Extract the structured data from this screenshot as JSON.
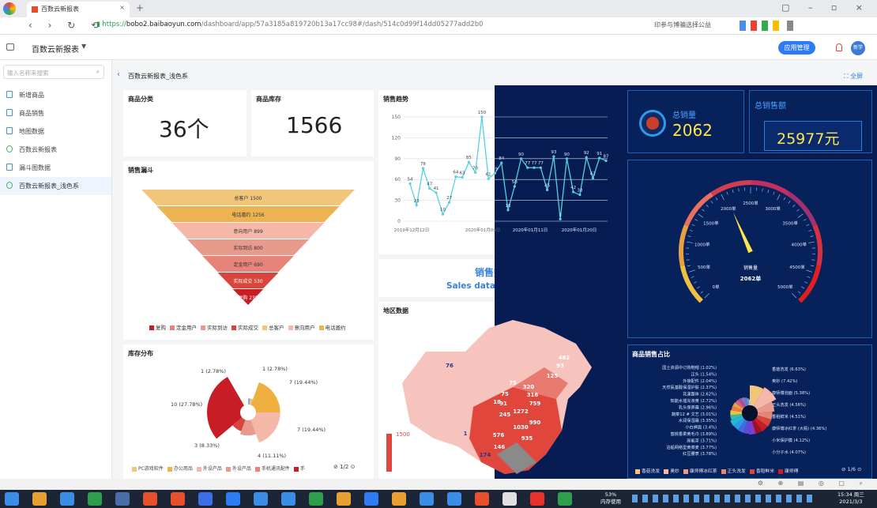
{
  "browser": {
    "tab_title": "百数云新报表",
    "url_secure": "https://",
    "url_host": "bobo2.baibaoyun.com",
    "url_path": "/dashboard/app/57a3185a819720b13a17cc98#/dash/514c0d99f14dd05277add2b0",
    "search_hint": "印参与博骗选择公益"
  },
  "app": {
    "title": "百数云新报表",
    "manage_btn": "应用管理",
    "user": "新学"
  },
  "sidebar": {
    "search_placeholder": "输入名称来搜索",
    "items": [
      "新增商品",
      "商品销售",
      "地图数据",
      "百数云新报表",
      "漏斗图数据",
      "百数云新报表_浅色系"
    ]
  },
  "page": {
    "breadcrumb": "百数云新报表_浅色系",
    "fullscreen": "全屏"
  },
  "kpi": {
    "category_title": "商品分类",
    "category_value": "36个",
    "stock_title": "商品库存",
    "stock_value": "1566"
  },
  "trend": {
    "title": "销售趋势",
    "yticks": [
      "150",
      "120",
      "90",
      "60",
      "30",
      "0"
    ],
    "xticks": [
      "2019年12月12日",
      "2020年01月09日",
      "2020年01月11日",
      "2020年01月20日"
    ],
    "labels": [
      "54",
      "23",
      "76",
      "47",
      "41",
      "10",
      "27",
      "64",
      "63",
      "85",
      "70",
      "150",
      "61",
      "69",
      "84",
      "16",
      "50",
      "90",
      "77",
      "77",
      "77",
      "45",
      "93",
      "3",
      "90",
      "42",
      "38",
      "92",
      "62",
      "91",
      "87"
    ]
  },
  "funnel": {
    "title": "销售漏斗",
    "stages": [
      "总客户 1500",
      "电话邀约 1256",
      "意向用户 899",
      "实际到访 800",
      "定金用户 690",
      "实际成交 530",
      "复购 235"
    ],
    "legend": [
      "复购",
      "定金用户",
      "实际到访",
      "实际成交",
      "总客户",
      "意向用户",
      "电话邀约"
    ]
  },
  "board": {
    "title_cn": "销售数据看板",
    "title_en": "Sales data Display Board"
  },
  "map": {
    "title": "地区数据",
    "scale_max": "1500",
    "scale_min": "1",
    "numbers": [
      "76",
      "482",
      "93",
      "125",
      "320",
      "75",
      "316",
      "75",
      "18",
      "91",
      "245",
      "1272",
      "759",
      "990",
      "1030",
      "935",
      "576",
      "146",
      "174",
      "1"
    ]
  },
  "stock": {
    "title": "库存分布",
    "labels": [
      "1 (2.78%)",
      "1 (2.78%)",
      "7 (19.44%)",
      "10 (27.78%)",
      "7 (19.44%)",
      "3 (8.33%)",
      "4 (11.11%)"
    ],
    "legend": [
      "PC游戏软件",
      "办公用品",
      "外设产品",
      "外设产品",
      "手机通讯配件",
      "手"
    ],
    "page": "1/2"
  },
  "dash": {
    "total_sales_label": "总销量",
    "total_sales": "2062",
    "total_amount_label": "总销售额",
    "total_amount": "25977元",
    "gauge_ticks": [
      "0单",
      "500单",
      "1000单",
      "1500单",
      "2000单",
      "2500单",
      "3000单",
      "3500单",
      "4000单",
      "4500单",
      "5000单"
    ],
    "gauge_name": "销售量",
    "gauge_value": "2062单",
    "share_title": "商品销售占比",
    "share_left": [
      "国土资源中订购鞋帽 (1.02%)",
      "正头 (1.54%)",
      "外接配件 (2.04%)",
      "天然氨基酸保湿护肤 (2.37%)",
      "花漾整体 (2.62%)",
      "知能水插充液黄 (2.72%)",
      "乳头保养霜 (2.96%)",
      "蔬菜12 # 文艺 (3.01%)",
      "水润保湿霜 (3.35%)",
      "小白裤面 (3.4%)",
      "蜜桃香柔黄毛巾 (3.89%)",
      "高能茶 (3.71%)",
      "泊船网络型黄菜麦 (3.77%)",
      "红豆腰表 (3.78%)"
    ],
    "share_right": [
      "香菇洗发 (6.63%)",
      "奥妙 (7.42%)",
      "康师傅泡面 (5.38%)",
      "正头洗发 (4.56%)",
      "香稻鲜米 (4.51%)",
      "康师傅冰红茶 (大瓶) (4.36%)",
      "小米保护膜 (4.12%)",
      "小分子水 (4.07%)"
    ],
    "share_legend": [
      "香菇洗发",
      "奥妙",
      "康师傅冰红茶",
      "正头洗发",
      "香稻鲜米",
      "康师傅"
    ],
    "share_page": "1/6"
  },
  "taskbar": {
    "pct": "53%",
    "mem": "内存使用",
    "time": "15:34 周三",
    "date": "2021/3/3"
  },
  "colors": {
    "accent": "#2d7cf6",
    "dark_bg": "#071c52",
    "funnel_top": "#f2c67a",
    "funnel_bottom": "#c81d25"
  }
}
